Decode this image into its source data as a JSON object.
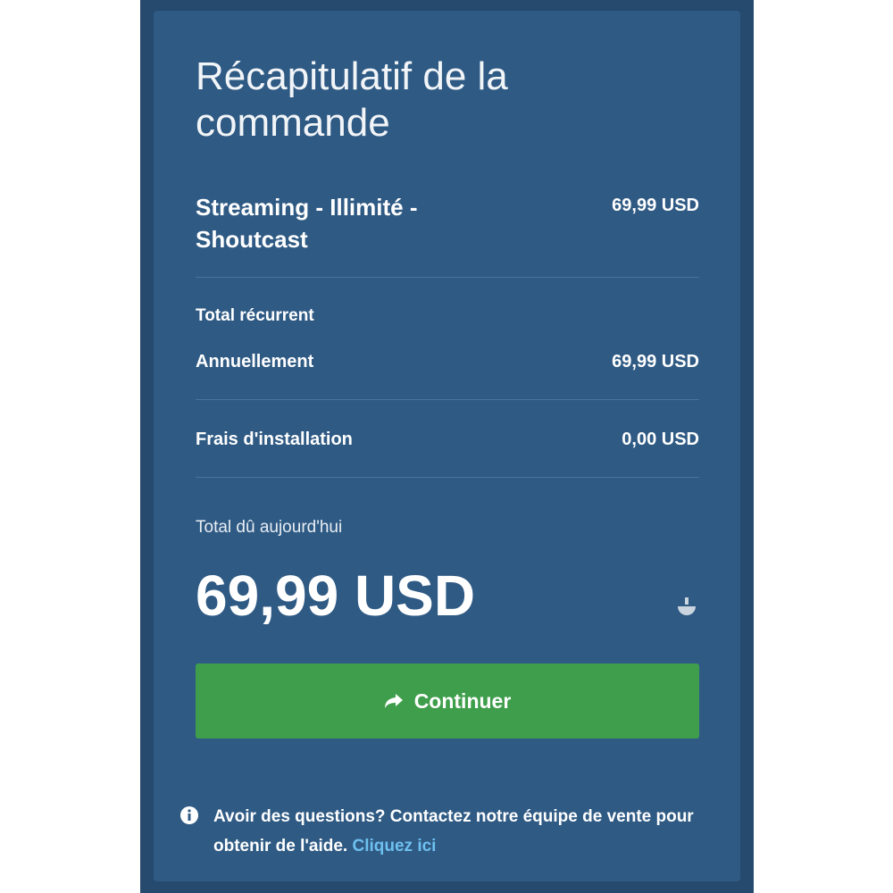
{
  "summary": {
    "title": "Récapitulatif de la commande",
    "item": {
      "name": "Streaming - Illimité - Shoutcast",
      "price": "69,99 USD"
    },
    "recurring_label": "Total récurrent",
    "annual": {
      "label": "Annuellement",
      "value": "69,99 USD"
    },
    "setup": {
      "label": "Frais d'installation",
      "value": "0,00 USD"
    },
    "due_today_label": "Total dû aujourd'hui",
    "total": "69,99 USD",
    "continue_label": "Continuer",
    "help": {
      "text": "Avoir des questions? Contactez notre équipe de vente pour obtenir de l'aide.",
      "link": "Cliquez ici"
    }
  },
  "colors": {
    "outer_bg": "#264a6d",
    "panel_bg": "#2f5a84",
    "button": "#3f9e4c",
    "link": "#6dc0ef"
  },
  "icons": [
    "share-arrow-icon",
    "info-circle-icon",
    "bowl-icon"
  ]
}
